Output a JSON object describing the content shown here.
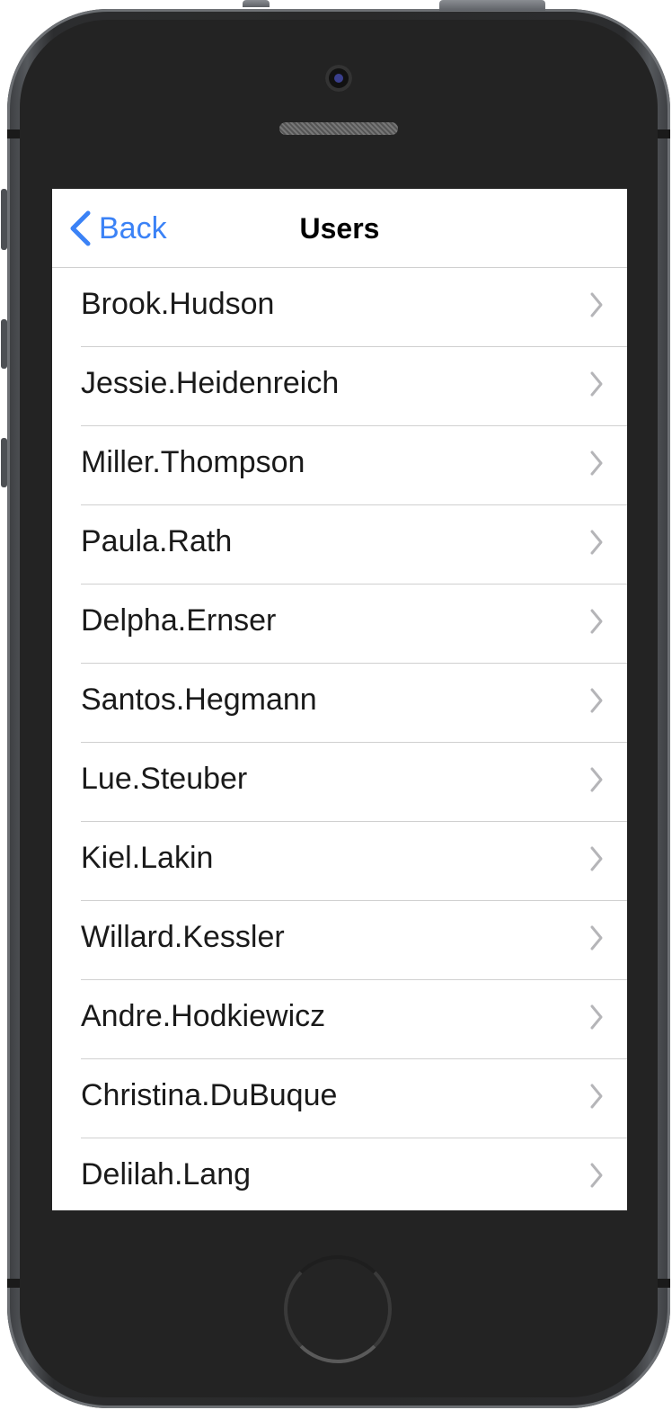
{
  "navbar": {
    "back_label": "Back",
    "title": "Users"
  },
  "users": [
    {
      "name": "Brook.Hudson"
    },
    {
      "name": "Jessie.Heidenreich"
    },
    {
      "name": "Miller.Thompson"
    },
    {
      "name": "Paula.Rath"
    },
    {
      "name": "Delpha.Ernser"
    },
    {
      "name": "Santos.Hegmann"
    },
    {
      "name": "Lue.Steuber"
    },
    {
      "name": "Kiel.Lakin"
    },
    {
      "name": "Willard.Kessler"
    },
    {
      "name": "Andre.Hodkiewicz"
    },
    {
      "name": "Christina.DuBuque"
    },
    {
      "name": "Delilah.Lang"
    }
  ],
  "icons": {
    "back": "chevron-left-icon",
    "row": "chevron-right-icon"
  },
  "colors": {
    "accent": "#3b82f6",
    "separator": "#d0d0d0",
    "chevron": "#b5b5b8"
  }
}
